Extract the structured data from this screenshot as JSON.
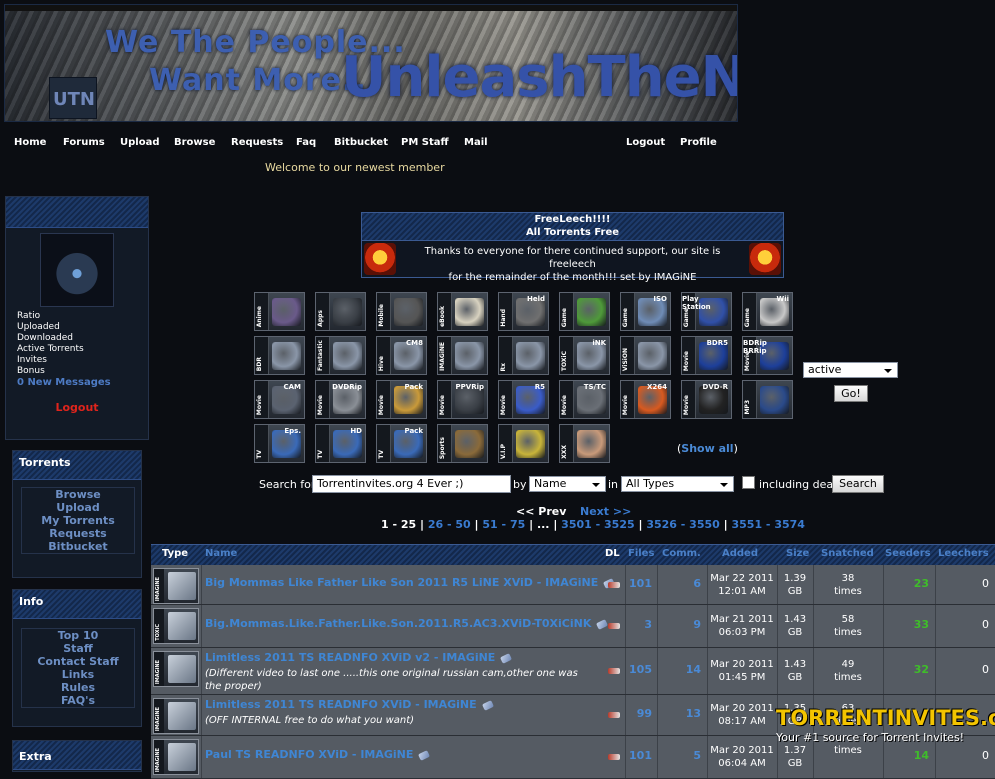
{
  "banner": {
    "logo": "UTN",
    "slogan_line1": "We The People...",
    "slogan_line2": "Want More...",
    "title": "UnleashTheNet"
  },
  "nav": {
    "items": [
      "Home",
      "Forums",
      "Upload",
      "Browse",
      "Requests",
      "Faq",
      "Bitbucket",
      "PM Staff",
      "Mail"
    ],
    "right": [
      "Logout",
      "Profile"
    ],
    "welcome": "Welcome to our newest member"
  },
  "user_panel": {
    "stats": [
      "Ratio",
      "Uploaded",
      "Downloaded",
      "Active Torrents",
      "Invites",
      "Bonus"
    ],
    "messages": "0 New Messages",
    "logout": "Logout"
  },
  "torrents_panel": {
    "title": "Torrents",
    "links": [
      "Browse",
      "Upload",
      "My Torrents",
      "Requests",
      "Bitbucket"
    ]
  },
  "info_panel": {
    "title": "Info",
    "links": [
      "Top 10",
      "Staff",
      "Contact Staff",
      "Links",
      "Rules",
      "FAQ's"
    ]
  },
  "extra_panel": {
    "title": "Extra"
  },
  "freeleech": {
    "title1": "FreeLeech!!!!",
    "title2": "All Torrents Free",
    "message_line1": "Thanks to everyone for there continued support, our site is freeleech",
    "message_line2": "for the remainder of the month!!! set by IMAGiNE"
  },
  "categories": [
    [
      {
        "label": "Anime",
        "tag": "",
        "icon": "anime-icon",
        "color": "#6a5a8a"
      },
      {
        "label": "Apps",
        "tag": "",
        "icon": "apps-icon",
        "color": "#3a3f46"
      },
      {
        "label": "Mobile",
        "tag": "",
        "icon": "mobile-icon",
        "color": "#555"
      },
      {
        "label": "eBook",
        "tag": "",
        "icon": "ebook-icon",
        "color": "#d8d2c0"
      },
      {
        "label": "Hand",
        "tag": "Held",
        "icon": "handheld-icon",
        "color": "#707070"
      },
      {
        "label": "Game",
        "tag": "",
        "icon": "xbox-icon",
        "color": "#4f9a3a"
      },
      {
        "label": "Game",
        "tag": "ISO",
        "icon": "game-iso-icon",
        "color": "#6f8cb6"
      },
      {
        "label": "Game",
        "tag": "Play Station",
        "icon": "playstation-icon",
        "color": "#3050a8"
      },
      {
        "label": "Game",
        "tag": "Wii",
        "icon": "wii-icon",
        "color": "#c8c8c8"
      }
    ],
    [
      {
        "label": "BDR",
        "tag": "",
        "icon": "bdr-icon",
        "color": "#8a96a8"
      },
      {
        "label": "Fantastic",
        "tag": "",
        "icon": "fantastic-icon",
        "color": "#8a96a8"
      },
      {
        "label": "Hive",
        "tag": "CM8",
        "icon": "hive-cm8-icon",
        "color": "#8a96a8"
      },
      {
        "label": "IMAGiNE",
        "tag": "",
        "icon": "imagine-icon",
        "color": "#8a96a8"
      },
      {
        "label": "Rx",
        "tag": "",
        "icon": "rx-icon",
        "color": "#8a96a8"
      },
      {
        "label": "TOXiC",
        "tag": "iNK",
        "icon": "toxic-ink-icon",
        "color": "#8a96a8"
      },
      {
        "label": "ViSiON",
        "tag": "",
        "icon": "vision-icon",
        "color": "#8a96a8"
      },
      {
        "label": "Movie",
        "tag": "BDR5",
        "icon": "bdr5-icon",
        "color": "#1d3f9a"
      },
      {
        "label": "Movie",
        "tag": "BDRip BRRip",
        "icon": "bdrip-icon",
        "color": "#1d3f9a"
      }
    ],
    [
      {
        "label": "Movie",
        "tag": "CAM",
        "icon": "camera-icon",
        "color": "#5a6270"
      },
      {
        "label": "Movie",
        "tag": "DVDRip",
        "icon": "dvdrip-icon",
        "color": "#8a8f96"
      },
      {
        "label": "Movie",
        "tag": "Pack",
        "icon": "pack-icon",
        "color": "#c99a3a"
      },
      {
        "label": "Movie",
        "tag": "PPVRip",
        "icon": "ppv-icon",
        "color": "#3a3f46"
      },
      {
        "label": "Movie",
        "tag": "R5",
        "icon": "r5-icon",
        "color": "#3a5cc8"
      },
      {
        "label": "Movie",
        "tag": "TS/TC",
        "icon": "tstc-icon",
        "color": "#6a6f76"
      },
      {
        "label": "Movie",
        "tag": "X264",
        "icon": "x264-icon",
        "color": "#d85a20"
      },
      {
        "label": "Movie",
        "tag": "DVD-R",
        "icon": "dvdr-icon",
        "color": "#222"
      },
      {
        "label": "MP3",
        "tag": "",
        "icon": "mp3-icon",
        "color": "#2a4a8a"
      }
    ],
    [
      {
        "label": "TV",
        "tag": "Eps.",
        "icon": "tv-eps-icon",
        "color": "#3a6ab8"
      },
      {
        "label": "TV",
        "tag": "HD",
        "icon": "tv-hd-icon",
        "color": "#3a6ab8"
      },
      {
        "label": "TV",
        "tag": "Pack",
        "icon": "tv-pack-icon",
        "color": "#3a6ab8"
      },
      {
        "label": "Sports",
        "tag": "",
        "icon": "sports-icon",
        "color": "#8a6a3a"
      },
      {
        "label": "V.I.P",
        "tag": "",
        "icon": "vip-icon",
        "color": "#c8b43a"
      },
      {
        "label": "XXX",
        "tag": "",
        "icon": "xxx-icon",
        "color": "#c89a7a"
      }
    ]
  ],
  "show_all": {
    "prefix": "(",
    "link": "Show all",
    "suffix": ")"
  },
  "filter": {
    "status": "active",
    "go": "Go!"
  },
  "search": {
    "label": "Search for",
    "value": "Torrentinvites.org 4 Ever ;)",
    "by": "by",
    "by_value": "Name",
    "in": "in",
    "in_value": "All Types",
    "dead_label": "including dead",
    "button": "Search"
  },
  "pagination": {
    "prev": "<< Prev",
    "next": "Next >>",
    "current": "1 - 25",
    "pages": [
      "26 - 50",
      "51 - 75",
      "...",
      "3501 - 3525",
      "3526 - 3550",
      "3551 - 3574"
    ],
    "sep": " | "
  },
  "table": {
    "headers": {
      "type": "Type",
      "name": "Name",
      "dl": "DL",
      "files": "Files",
      "comm": "Comm.",
      "added": "Added",
      "size": "Size",
      "snatched": "Snatched",
      "seeders": "Seeders",
      "leechers": "Leechers"
    },
    "rows": [
      {
        "type": "IMAGiNE",
        "name": "Big Mommas Like Father Like Son 2011 R5 LiNE XViD - IMAGiNE",
        "desc": "",
        "files": "101",
        "comm": "6",
        "date": "Mar 22 2011",
        "time": "12:01 AM",
        "size1": "1.39",
        "size2": "GB",
        "snatched": "38",
        "times": "times",
        "seeders": "23",
        "leechers": "0"
      },
      {
        "type": "TOXiC",
        "name": "Big.Mommas.Like.Father.Like.Son.2011.R5.AC3.XViD-T0XiCiNK",
        "desc": "",
        "files": "3",
        "comm": "9",
        "date": "Mar 21 2011",
        "time": "06:03 PM",
        "size1": "1.43",
        "size2": "GB",
        "snatched": "58",
        "times": "times",
        "seeders": "33",
        "leechers": "0"
      },
      {
        "type": "IMAGiNE",
        "name": "Limitless 2011 TS READNFO XViD v2 - IMAGiNE",
        "desc": "(Different video to last one .....this one original russian cam,other one was the proper)",
        "files": "105",
        "comm": "14",
        "date": "Mar 20 2011",
        "time": "01:45 PM",
        "size1": "1.43",
        "size2": "GB",
        "snatched": "49",
        "times": "times",
        "seeders": "32",
        "leechers": "0"
      },
      {
        "type": "IMAGiNE",
        "name": "Limitless 2011 TS READNFO XViD - IMAGiNE",
        "desc": "(OFF INTERNAL free to do what you want)",
        "files": "99",
        "comm": "13",
        "date": "Mar 20 2011",
        "time": "08:17 AM",
        "size1": "1.35",
        "size2": "GB",
        "snatched": "63",
        "times": "times",
        "seeders": "",
        "leechers": ""
      },
      {
        "type": "IMAGiNE",
        "name": "Paul TS READNFO XViD - IMAGiNE",
        "desc": "",
        "files": "101",
        "comm": "5",
        "date": "Mar 20 2011",
        "time": "06:04 AM",
        "size1": "1.37",
        "size2": "GB",
        "snatched": "",
        "times": "times",
        "seeders": "14",
        "leechers": "0"
      }
    ]
  },
  "watermark": {
    "line1": "TORRENTINVITES.org",
    "line2": "Your #1 source for Torrent Invites!"
  }
}
